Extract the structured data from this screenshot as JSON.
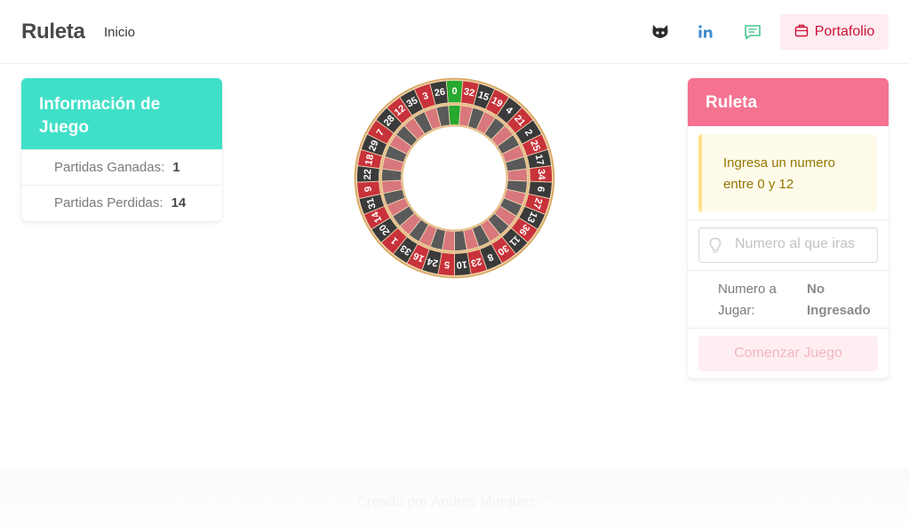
{
  "nav": {
    "brand": "Ruleta",
    "home_link": "Inicio",
    "icons": [
      "github-icon",
      "linkedin-icon",
      "chat-icon"
    ],
    "portfolio_label": "Portafolio",
    "portfolio_icon": "briefcase-icon"
  },
  "info": {
    "title": "Información de Juego",
    "wins_label": "Partidas Ganadas:",
    "wins_value": "1",
    "losses_label": "Partidas Perdidas:",
    "losses_value": "14"
  },
  "wheel": {
    "numbers": [
      0,
      32,
      15,
      19,
      4,
      21,
      2,
      25,
      17,
      34,
      6,
      27,
      13,
      36,
      11,
      30,
      8,
      23,
      10,
      5,
      24,
      16,
      33,
      1,
      20,
      14,
      31,
      9,
      22,
      18,
      29,
      7,
      28,
      12,
      35,
      3,
      26
    ],
    "colors": {
      "red": "#c8323a",
      "black": "#3a3a3a",
      "green": "#27a82f",
      "rim": "#d6a45c"
    }
  },
  "game": {
    "title": "Ruleta",
    "notice": "Ingresa un numero entre 0 y 12",
    "input_placeholder": "Numero al que iras",
    "play_label": "Numero a Jugar:",
    "play_value": "No Ingresado",
    "start_button": "Comenzar Juego"
  },
  "footer": {
    "text": "Creado por Andres Marquez ♡"
  },
  "colors": {
    "info_accent": "#40e0c8",
    "game_accent": "#f57290",
    "portfolio_bg": "#feecf0",
    "portfolio_text": "#cc0f35"
  }
}
